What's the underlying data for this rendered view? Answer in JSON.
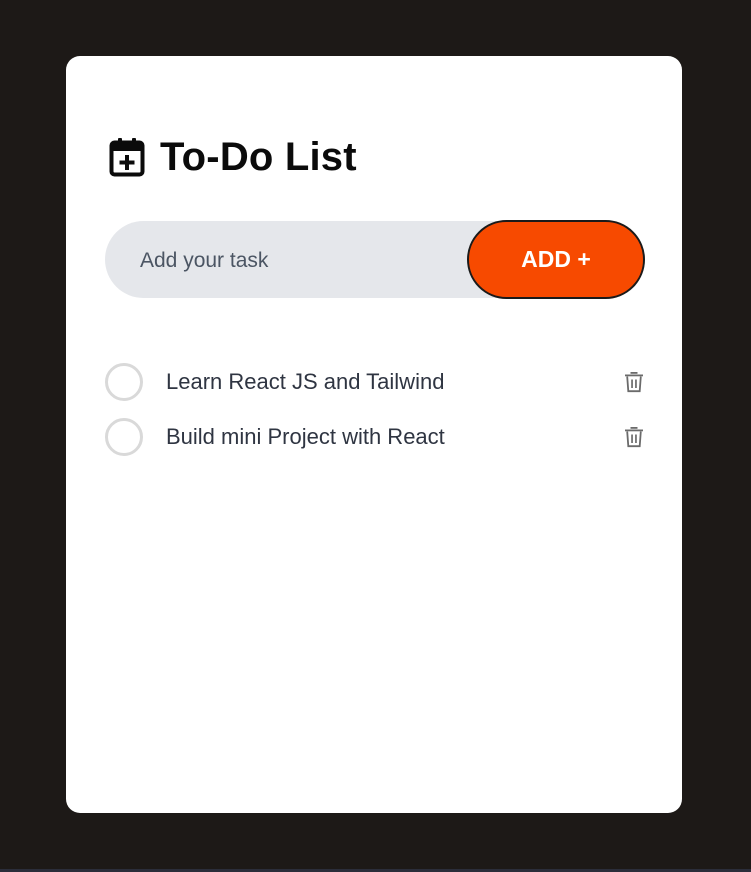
{
  "app": {
    "title": "To-Do List",
    "title_icon": "calendar-plus-icon"
  },
  "input": {
    "placeholder": "Add your task",
    "value": ""
  },
  "add_button": {
    "label": "ADD +",
    "color": "#f74a00"
  },
  "todos": [
    {
      "text": "Learn React JS and Tailwind",
      "completed": false,
      "delete_icon": "trash-icon"
    },
    {
      "text": "Build mini Project with React",
      "completed": false,
      "delete_icon": "trash-icon"
    }
  ],
  "colors": {
    "background": "#1d1917",
    "card": "#ffffff",
    "input_background": "#e5e7eb",
    "accent": "#f74a00"
  }
}
